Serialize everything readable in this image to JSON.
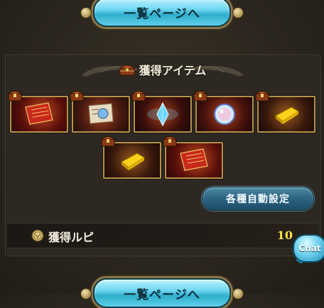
{
  "nav": {
    "top_button_label": "一覧ページへ",
    "bottom_button_label": "一覧ページへ"
  },
  "panel": {
    "title": "獲得アイテム",
    "title_icon": "treasure-chest-icon"
  },
  "items": [
    {
      "name": "red-scroll",
      "icon": "red-scroll-icon",
      "bg": "#5a0f0a",
      "accent": "#c8281c"
    },
    {
      "name": "blue-scroll",
      "icon": "blue-scroll-icon",
      "bg": "#4a1a10",
      "accent": "#d8c8a0"
    },
    {
      "name": "blue-crystal",
      "icon": "blue-crystal-icon",
      "bg": "#3b0f0b",
      "accent": "#6ad8ff"
    },
    {
      "name": "crystal-orb",
      "icon": "crystal-orb-icon",
      "bg": "#4a120c",
      "accent": "#f0c8e0"
    },
    {
      "name": "gold-bar",
      "icon": "gold-bar-icon",
      "bg": "#3a1a0c",
      "accent": "#ffd11a"
    },
    {
      "name": "gold-bar",
      "icon": "gold-bar-icon",
      "bg": "#3a1a0c",
      "accent": "#ffd11a"
    },
    {
      "name": "red-scroll",
      "icon": "red-scroll-icon",
      "bg": "#5a0f0a",
      "accent": "#c8281c"
    }
  ],
  "auto_settings": {
    "label": "各種自動設定"
  },
  "rupie": {
    "label": "獲得ルピ",
    "value": "10",
    "icon": "coin-icon"
  },
  "chat": {
    "label": "Chat"
  },
  "colors": {
    "accent_cyan": "#6fd7f0",
    "gold_frame": "#b3924b",
    "rupie_value": "#ffe24a"
  }
}
